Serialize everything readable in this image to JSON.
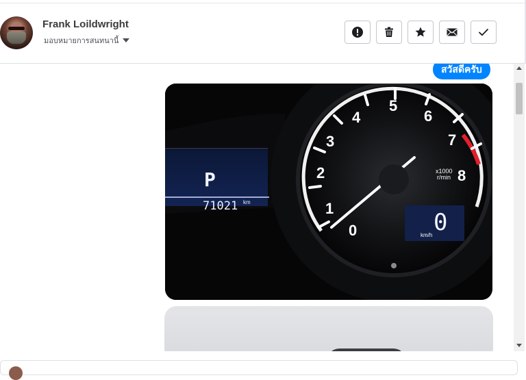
{
  "conversation": {
    "contact_name": "Frank Loildwright",
    "assign_label": "มอบหมายการสนทนานี้"
  },
  "messages": [
    {
      "type": "text",
      "text": "สวัสดีครับ"
    },
    {
      "type": "image",
      "content": "car-instrument-cluster-photo",
      "odometer": "71021",
      "odometer_unit": "km",
      "gear": "P",
      "speed": "0",
      "speed_unit": "km/h",
      "tach_multiplier": "x1000",
      "tach_unit": "r/min",
      "tach_marks": [
        "0",
        "1",
        "2",
        "3",
        "4",
        "5",
        "6",
        "7",
        "8"
      ]
    },
    {
      "type": "image",
      "content": "partial-photo"
    }
  ],
  "actions": [
    {
      "icon": "alert-icon"
    },
    {
      "icon": "trash-icon"
    },
    {
      "icon": "star-icon"
    },
    {
      "icon": "envelope-icon"
    },
    {
      "icon": "check-icon"
    }
  ],
  "colors": {
    "accent": "#0084ff",
    "button_border": "#c4c6ca",
    "redline": "#e0202c"
  }
}
